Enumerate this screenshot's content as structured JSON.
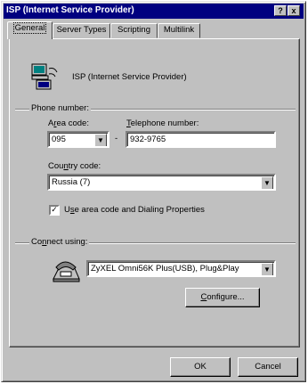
{
  "window": {
    "title": "ISP (Internet Service Provider)",
    "help_btn": "?",
    "close_btn": "x"
  },
  "tabs": [
    {
      "label": "General",
      "active": true
    },
    {
      "label": "Server Types",
      "active": false
    },
    {
      "label": "Scripting",
      "active": false
    },
    {
      "label": "Multilink",
      "active": false
    }
  ],
  "connection": {
    "name": "ISP (Internet Service Provider)"
  },
  "phone": {
    "section_label": "Phone number:",
    "area_code_label_pre": "A",
    "area_code_label_ul": "r",
    "area_code_label_post": "ea code:",
    "area_code_value": "095",
    "dash": "-",
    "telephone_label_pre": "",
    "telephone_label_ul": "T",
    "telephone_label_post": "elephone number:",
    "telephone_value": "932-9765",
    "country_label_pre": "Cou",
    "country_label_ul": "n",
    "country_label_post": "try code:",
    "country_value": "Russia (7)",
    "use_area_code_pre": "U",
    "use_area_code_ul": "s",
    "use_area_code_post": "e area code and Dialing Properties",
    "use_area_code_checked": true
  },
  "connect": {
    "section_label_pre": "Co",
    "section_label_ul": "n",
    "section_label_post": "nect using:",
    "modem_value": "ZyXEL Omni56K Plus(USB), Plug&Play",
    "configure_pre": "",
    "configure_ul": "C",
    "configure_post": "onfigure..."
  },
  "footer": {
    "ok_label": "OK",
    "cancel_label": "Cancel"
  },
  "icons": {
    "computer": "dialup-computer-icon",
    "modem": "modem-phone-icon",
    "dropdown": "chevron-down-icon"
  }
}
